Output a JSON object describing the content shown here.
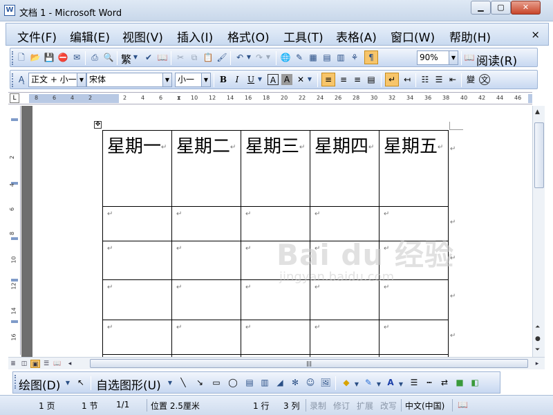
{
  "window": {
    "title": "文档 1 - Microsoft Word",
    "app_icon": "W"
  },
  "menu": [
    "文件(F)",
    "编辑(E)",
    "视图(V)",
    "插入(I)",
    "格式(O)",
    "工具(T)",
    "表格(A)",
    "窗口(W)",
    "帮助(H)"
  ],
  "menu_close": "×",
  "toolbar": {
    "traditional": "繁",
    "zoom": "90%",
    "read": "阅读(R)"
  },
  "format": {
    "style": "正文 + 小一",
    "font": "宋体",
    "size": "小一",
    "bold": "B",
    "italic": "I",
    "underline": "U",
    "char_border": "A",
    "char_shading": "A",
    "phonetic": "文"
  },
  "ruler": {
    "h_ticks": [
      "8",
      "6",
      "4",
      "2",
      "2",
      "4",
      "6",
      "8",
      "10",
      "12",
      "14",
      "16",
      "18",
      "20",
      "22",
      "24",
      "26",
      "28",
      "30",
      "32",
      "34",
      "36",
      "38",
      "40",
      "42",
      "44",
      "46",
      "48"
    ],
    "v_ticks": [
      "2",
      "4",
      "6",
      "8",
      "10",
      "12",
      "14",
      "16"
    ]
  },
  "table": {
    "headers": [
      "星期一",
      "星期二",
      "星期三",
      "星期四",
      "星期五"
    ],
    "row_count": 5,
    "paragraph_mark": "↵"
  },
  "watermark": {
    "line1": "Bai du 经验",
    "line2": "jingyan.baidu.com"
  },
  "drawing": {
    "draw": "绘图(D)",
    "autoshape": "自选图形(U)"
  },
  "status": {
    "page": "1 页",
    "section": "1 节",
    "page_of": "1/1",
    "position": "位置 2.5厘米",
    "line": "1 行",
    "col": "3 列",
    "rec": "录制",
    "trk": "修订",
    "ext": "扩展",
    "ovr": "改写",
    "lang": "中文(中国)"
  },
  "colors": {
    "accent": "#c7d8f1",
    "active": "#f7c56a"
  }
}
